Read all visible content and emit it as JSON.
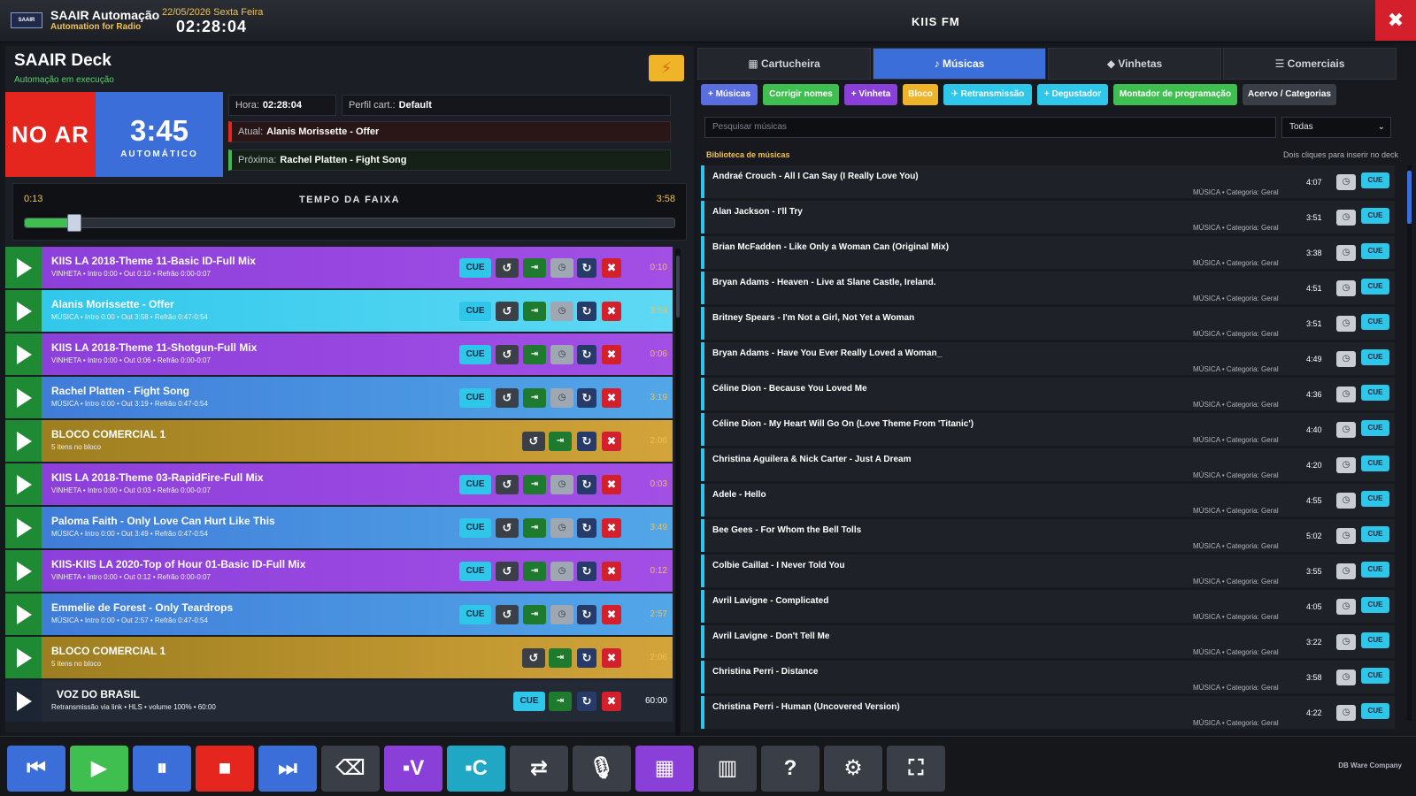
{
  "header": {
    "logo_text": "SAAIR",
    "app_name": "SAAIR Automação",
    "app_subtitle": "Automation for Radio",
    "date": "22/05/2026 Sexta Feira",
    "clock": "02:28:04",
    "station": "KIIS FM",
    "close_glyph": "✖"
  },
  "deck": {
    "title": "SAAIR Deck",
    "status": "Automação em execução",
    "flash_glyph": "⚡",
    "on_air": "NO AR",
    "timer": "3:45",
    "mode": "AUTOMÁTICO",
    "hora_label": "Hora:",
    "hora_value": "02:28:04",
    "perfil_label": "Perfil cart.:",
    "perfil_value": "Default",
    "atual_label": "Atual:",
    "atual_value": "Alanis Morissette - Offer",
    "proxima_label": "Próxima:",
    "proxima_value": "Rachel Platten - Fight Song",
    "track": {
      "elapsed": "0:13",
      "label": "TEMPO DA FAIXA",
      "total": "3:58",
      "progress": 0.06
    }
  },
  "queue": [
    {
      "title": "KIIS LA 2018-Theme 11-Basic ID-Full Mix",
      "meta": "VINHETA • Intro 0:00 • Out 0:10 • Refrão 0:00-0:07",
      "dur": "0:10",
      "kind": "vinheta"
    },
    {
      "title": "Alanis Morissette - Offer",
      "meta": "MÚSICA • Intro 0:00 • Out 3:58 • Refrão 0:47-0:54",
      "dur": "3:58",
      "kind": "current"
    },
    {
      "title": "KIIS LA 2018-Theme 11-Shotgun-Full Mix",
      "meta": "VINHETA • Intro 0:00 • Out 0:06 • Refrão 0:00-0:07",
      "dur": "0:06",
      "kind": "vinheta"
    },
    {
      "title": "Rachel Platten - Fight Song",
      "meta": "MÚSICA • Intro 0:00 • Out 3:19 • Refrão 0:47-0:54",
      "dur": "3:19",
      "kind": "musica"
    },
    {
      "title": "BLOCO COMERCIAL 1",
      "meta": "5 itens no bloco",
      "dur": "2:06",
      "kind": "bloco"
    },
    {
      "title": "KIIS LA 2018-Theme 03-RapidFire-Full Mix",
      "meta": "VINHETA • Intro 0:00 • Out 0:03 • Refrão 0:00-0:07",
      "dur": "0:03",
      "kind": "vinheta"
    },
    {
      "title": "Paloma Faith - Only Love Can Hurt Like This",
      "meta": "MÚSICA • Intro 0:00 • Out 3:49 • Refrão 0:47-0:54",
      "dur": "3:49",
      "kind": "musica"
    },
    {
      "title": "KIIS-KIIS LA 2020-Top of Hour 01-Basic ID-Full Mix",
      "meta": "VINHETA • Intro 0:00 • Out 0:12 • Refrão 0:00-0:07",
      "dur": "0:12",
      "kind": "vinheta"
    },
    {
      "title": "Emmelie de Forest - Only Teardrops",
      "meta": "MÚSICA • Intro 0:00 • Out 2:57 • Refrão 0:47-0:54",
      "dur": "2:57",
      "kind": "musica"
    },
    {
      "title": "BLOCO COMERCIAL 1",
      "meta": "5 itens no bloco",
      "dur": "2:06",
      "kind": "bloco"
    },
    {
      "title": "VOZ DO BRASIL",
      "meta": "Retransmissão via link • HLS • volume 100% • 60:00",
      "dur": "60:00",
      "kind": "retrans"
    }
  ],
  "row_buttons": {
    "cue": "CUE",
    "rew": "↺",
    "next": "⇥",
    "clock": "◷",
    "loop": "↻",
    "del": "✖",
    "play": "▶",
    "antenna": "✈"
  },
  "right": {
    "tabs": [
      "▦ Cartucheira",
      "♪ Músicas",
      "◆ Vinhetas",
      "☰ Comerciais"
    ],
    "active_tab": 1,
    "toolbar": [
      {
        "label": "+ Músicas",
        "color": "#5b6ee0"
      },
      {
        "label": "Corrigir nomes",
        "color": "#3fbf4f"
      },
      {
        "label": "+ Vinheta",
        "color": "#8b3fd9"
      },
      {
        "label": "Bloco",
        "color": "#f0b429"
      },
      {
        "label": "✈ Retransmissão",
        "color": "#2ec7ea"
      },
      {
        "label": "+ Degustador",
        "color": "#2ec7ea"
      },
      {
        "label": "Montador de programação",
        "color": "#3fbf4f"
      },
      {
        "label": "Acervo / Categorias",
        "color": "#3a3e46"
      }
    ],
    "search_placeholder": "Pesquisar músicas",
    "filter_value": "Todas",
    "library_title": "Biblioteca de músicas",
    "library_hint": "Dois cliques para inserir no deck",
    "item_meta": "MÚSICA • Categoria: Geral",
    "items": [
      {
        "title": "Andraé Crouch - All I Can Say (I Really Love You)",
        "dur": "4:07"
      },
      {
        "title": "Alan Jackson - I'll Try",
        "dur": "3:51"
      },
      {
        "title": "Brian McFadden - Like Only a Woman Can (Original Mix)",
        "dur": "3:38"
      },
      {
        "title": "Bryan Adams - Heaven - Live at Slane Castle, Ireland.",
        "dur": "4:51"
      },
      {
        "title": "Britney Spears - I'm Not a Girl, Not Yet a Woman",
        "dur": "3:51"
      },
      {
        "title": "Bryan Adams - Have You Ever Really Loved a Woman_",
        "dur": "4:49"
      },
      {
        "title": "Céline Dion - Because You Loved Me",
        "dur": "4:36"
      },
      {
        "title": "Céline Dion - My Heart Will Go On (Love Theme From 'Titanic')",
        "dur": "4:40"
      },
      {
        "title": "Christina Aguilera & Nick Carter - Just A Dream",
        "dur": "4:20"
      },
      {
        "title": "Adele - Hello",
        "dur": "4:55"
      },
      {
        "title": "Bee Gees - For Whom the Bell Tolls",
        "dur": "5:02"
      },
      {
        "title": "Colbie Caillat - I Never Told You",
        "dur": "3:55"
      },
      {
        "title": "Avril Lavigne - Complicated",
        "dur": "4:05"
      },
      {
        "title": "Avril Lavigne - Don't Tell Me",
        "dur": "3:22"
      },
      {
        "title": "Christina Perri - Distance",
        "dur": "3:58"
      },
      {
        "title": "Christina Perri - Human (Uncovered Version)",
        "dur": "4:22"
      }
    ]
  },
  "bottom": {
    "buttons": [
      {
        "name": "previous-button",
        "glyph": "⏮",
        "color": "blue"
      },
      {
        "name": "play-button",
        "glyph": "▶",
        "color": "green"
      },
      {
        "name": "pause-button",
        "glyph": "⏸",
        "color": "blue"
      },
      {
        "name": "stop-button",
        "glyph": "■",
        "color": "red"
      },
      {
        "name": "skip-button",
        "glyph": "⏭",
        "color": "blue"
      },
      {
        "name": "eraser-button",
        "glyph": "⌫",
        "color": "grey"
      },
      {
        "name": "vinheta-button",
        "glyph": "▪V",
        "color": "purple"
      },
      {
        "name": "comercial-button",
        "glyph": "▪C",
        "color": "cyan"
      },
      {
        "name": "shuffle-button",
        "glyph": "⇄",
        "color": "grey"
      },
      {
        "name": "microphone-button",
        "glyph": "🎙",
        "color": "grey"
      },
      {
        "name": "grid-button",
        "glyph": "▦",
        "color": "purple"
      },
      {
        "name": "building-button",
        "glyph": "▥",
        "color": "grey"
      },
      {
        "name": "help-button",
        "glyph": "?",
        "color": "grey"
      },
      {
        "name": "settings-button",
        "glyph": "⚙",
        "color": "grey"
      },
      {
        "name": "fullscreen-button",
        "glyph": "⛶",
        "color": "grey"
      }
    ],
    "credit": "DB Ware Company"
  },
  "colors": {
    "vinheta": "#8b3fd9",
    "musica_a": "#3f7ad8",
    "musica_b": "#52a7e8",
    "current_a": "#2ec7ea",
    "current_b": "#5fd9f5",
    "bloco_a": "#9a7c1e",
    "bloco_b": "#d3a43a",
    "retrans": "#232a36"
  }
}
